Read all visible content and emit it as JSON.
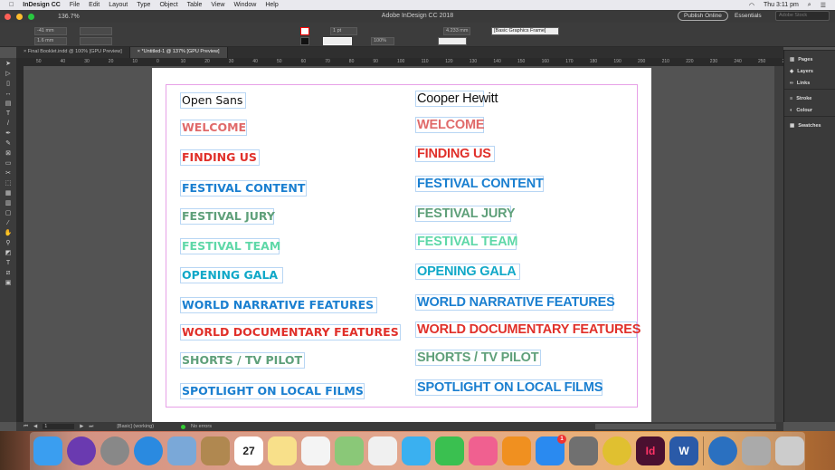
{
  "menubar": {
    "app": "InDesign CC",
    "items": [
      "File",
      "Edit",
      "Layout",
      "Type",
      "Object",
      "Table",
      "View",
      "Window",
      "Help"
    ],
    "clock": "Thu 3:11 pm"
  },
  "titlebar": {
    "zoom": "136.7%",
    "title": "Adobe InDesign CC 2018",
    "publish": "Publish Online",
    "workspace": "Essentials",
    "stock_placeholder": "Adobe Stock"
  },
  "control": {
    "x": "-41 mm",
    "y": "1.6 mm",
    "stroke": "1 pt",
    "scale": "100%",
    "offset": "4.233 mm",
    "style": "[Basic Graphics Frame]"
  },
  "tabs": [
    {
      "label": "Final Booklet.indd @ 100% [GPU Preview]",
      "active": false
    },
    {
      "label": "*Untitled-1 @ 137% [GPU Preview]",
      "active": true
    }
  ],
  "ruler": [
    "50",
    "40",
    "30",
    "20",
    "10",
    "0",
    "10",
    "20",
    "30",
    "40",
    "50",
    "60",
    "70",
    "80",
    "90",
    "100",
    "110",
    "120",
    "130",
    "140",
    "150",
    "160",
    "170",
    "180",
    "190",
    "200",
    "210",
    "220",
    "230",
    "240",
    "250",
    "260"
  ],
  "document": {
    "left": {
      "label": "Open Sans",
      "items": [
        {
          "text": "WELCOME",
          "color": "#e06a6a"
        },
        {
          "text": "FINDING US",
          "color": "#e0302a"
        },
        {
          "text": "FESTIVAL CONTENT",
          "color": "#1a7fd0"
        },
        {
          "text": "FESTIVAL JURY",
          "color": "#5fa07a"
        },
        {
          "text": "FESTIVAL TEAM",
          "color": "#5fd8a8"
        },
        {
          "text": "OPENING GALA",
          "color": "#10a8c8"
        },
        {
          "text": "WORLD NARRATIVE FEATURES",
          "color": "#1a7fd0"
        },
        {
          "text": "WORLD DOCUMENTARY FEATURES",
          "color": "#e0302a"
        },
        {
          "text": "SHORTS / TV PILOT",
          "color": "#5fa07a"
        },
        {
          "text": "SPOTLIGHT ON LOCAL FILMS",
          "color": "#1a7fd0"
        }
      ]
    },
    "right": {
      "label": "Cooper Hewitt",
      "items": [
        {
          "text": "WELCOME",
          "color": "#e06a6a"
        },
        {
          "text": "FINDING US",
          "color": "#e0302a"
        },
        {
          "text": "FESTIVAL CONTENT",
          "color": "#1a7fd0"
        },
        {
          "text": "FESTIVAL JURY",
          "color": "#5fa07a"
        },
        {
          "text": "FESTIVAL TEAM",
          "color": "#5fd8a8"
        },
        {
          "text": "OPENING GALA",
          "color": "#10a8c8"
        },
        {
          "text": "WORLD NARRATIVE FEATURES",
          "color": "#1a7fd0"
        },
        {
          "text": "WORLD DOCUMENTARY FEATURES",
          "color": "#e0302a"
        },
        {
          "text": "SHORTS / TV PILOT",
          "color": "#5fa07a"
        },
        {
          "text": "SPOTLIGHT ON LOCAL FILMS",
          "color": "#1a7fd0"
        }
      ]
    }
  },
  "panels": [
    "Pages",
    "Layers",
    "Links",
    "Stroke",
    "Colour",
    "Swatches"
  ],
  "status": {
    "page": "1",
    "style": "[Basic] (working)",
    "errors": "No errors"
  },
  "dock": [
    {
      "name": "finder",
      "color": "#3a9ef0"
    },
    {
      "name": "siri",
      "color": "#6a3ab0"
    },
    {
      "name": "launchpad",
      "color": "#888"
    },
    {
      "name": "safari",
      "color": "#2a8ae0"
    },
    {
      "name": "mail",
      "color": "#7aa8d8"
    },
    {
      "name": "contacts",
      "color": "#b08850"
    },
    {
      "name": "calendar",
      "color": "#fff",
      "text": "27"
    },
    {
      "name": "notes",
      "color": "#f8e08a"
    },
    {
      "name": "reminders",
      "color": "#f4f4f4"
    },
    {
      "name": "maps",
      "color": "#8ac878"
    },
    {
      "name": "photos",
      "color": "#f0f0f0"
    },
    {
      "name": "messages",
      "color": "#3ab0f0"
    },
    {
      "name": "facetime",
      "color": "#3ac050"
    },
    {
      "name": "itunes",
      "color": "#f06090"
    },
    {
      "name": "ibooks",
      "color": "#f09020"
    },
    {
      "name": "app-store",
      "color": "#2a8af0",
      "badge": "1"
    },
    {
      "name": "system-preferences",
      "color": "#707070"
    },
    {
      "name": "chrome",
      "color": "#e0c030"
    },
    {
      "name": "indesign",
      "color": "#4a1030",
      "text": "Id"
    },
    {
      "name": "word",
      "color": "#2a5aa8",
      "text": "W"
    },
    {
      "name": "globe",
      "color": "#2a70c0"
    },
    {
      "name": "photo-browser",
      "color": "#aaa"
    },
    {
      "name": "trash",
      "color": "#ccc"
    }
  ]
}
